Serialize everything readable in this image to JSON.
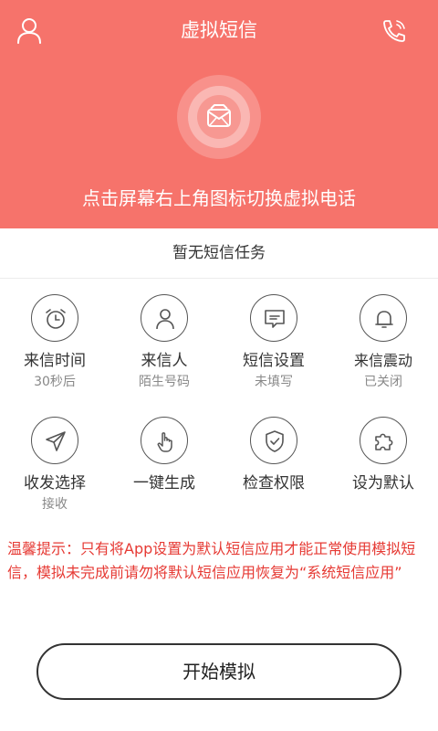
{
  "header": {
    "title": "虚拟短信",
    "switch_hint": "点击屏幕右上角图标切换虚拟电话",
    "accent_color": "#f6736b"
  },
  "status": {
    "text": "暂无短信任务"
  },
  "grid": {
    "items": [
      {
        "label": "来信时间",
        "sub": "30秒后",
        "icon": "alarm-clock-icon"
      },
      {
        "label": "来信人",
        "sub": "陌生号码",
        "icon": "person-icon"
      },
      {
        "label": "短信设置",
        "sub": "未填写",
        "icon": "message-icon"
      },
      {
        "label": "来信震动",
        "sub": "已关闭",
        "icon": "bell-icon"
      },
      {
        "label": "收发选择",
        "sub": "接收",
        "icon": "send-icon"
      },
      {
        "label": "一键生成",
        "sub": "",
        "icon": "tap-hand-icon"
      },
      {
        "label": "检查权限",
        "sub": "",
        "icon": "shield-check-icon"
      },
      {
        "label": "设为默认",
        "sub": "",
        "icon": "puzzle-icon"
      }
    ]
  },
  "warning": {
    "text": "温馨提示：只有将App设置为默认短信应用才能正常使用模拟短信，模拟未完成前请勿将默认短信应用恢复为“系统短信应用”"
  },
  "start_button": {
    "label": "开始模拟"
  }
}
